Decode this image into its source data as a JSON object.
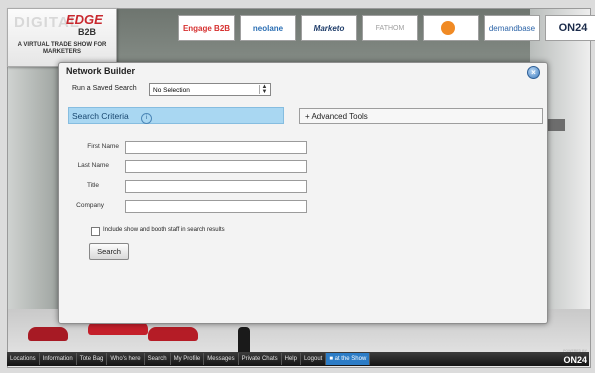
{
  "branding": {
    "logo_line1": "DIGITAL",
    "logo_line2": "EDGE",
    "logo_line3": "B2B",
    "logo_tagline": "A VIRTUAL TRADE SHOW FOR MARKETERS"
  },
  "sponsors": [
    "Engage B2B",
    "neolane",
    "Marketo",
    "FATHOM",
    " ",
    "demandbase",
    "ON24"
  ],
  "dialog": {
    "title": "Network Builder",
    "saved_search_label": "Run a Saved Search",
    "saved_search_value": "No Selection",
    "tab_search": "Search Criteria",
    "tab_advanced": "+ Advanced Tools",
    "fields": [
      {
        "label": "First Name",
        "value": ""
      },
      {
        "label": "Last Name",
        "value": ""
      },
      {
        "label": "Title",
        "value": ""
      },
      {
        "label": "Company",
        "value": ""
      }
    ],
    "checkbox_label": "Include show and booth staff in search results",
    "checkbox_checked": false,
    "search_button": "Search"
  },
  "navbar": {
    "items": [
      "Locations",
      "Information",
      "Tote Bag",
      "Who's here",
      "Search",
      "My Profile",
      "Messages",
      "Private Chats",
      "Help",
      "Logout"
    ],
    "show_item": "at the Show",
    "powered_by": "POWERED BY",
    "brand": "ON24"
  },
  "stage": {
    "sign": " "
  }
}
